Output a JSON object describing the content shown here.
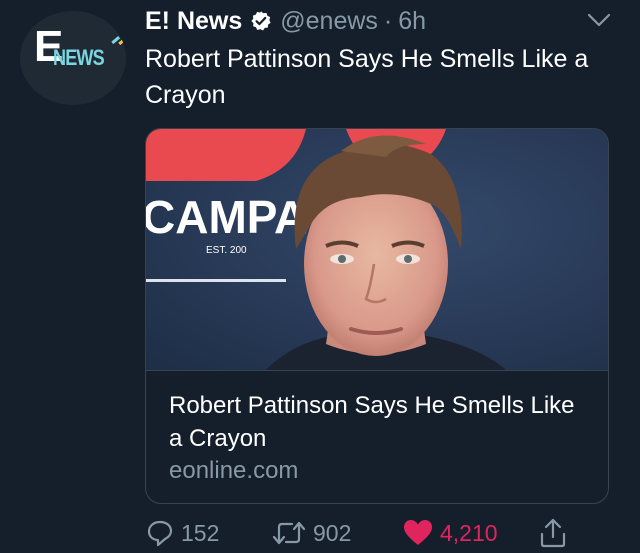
{
  "account": {
    "name": "E! News",
    "handle": "@enews",
    "separator": "·",
    "time": "6h",
    "avatar_text_e": "E",
    "avatar_text_news": "NEWS"
  },
  "tweet": {
    "text": "Robert Pattinson Says He Smells Like a Crayon"
  },
  "card": {
    "title": "Robert Pattinson Says He Smells Like a Crayon",
    "domain": "eonline.com",
    "backdrop_text": "CAMPA",
    "backdrop_small": "EST. 200"
  },
  "actions": {
    "replies": "152",
    "retweets": "902",
    "likes": "4,210"
  },
  "icons": {
    "verified": "verified-badge-icon",
    "menu": "chevron-down-icon",
    "reply": "reply-icon",
    "retweet": "retweet-icon",
    "like": "heart-icon",
    "share": "share-icon"
  },
  "colors": {
    "background": "#151f2b",
    "secondary_text": "#8899a6",
    "like": "#e0245e",
    "border": "#38444d"
  }
}
